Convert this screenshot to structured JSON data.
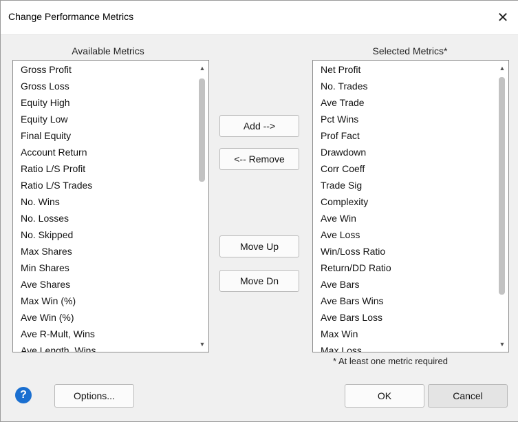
{
  "window": {
    "title": "Change Performance Metrics",
    "close_glyph": "✕"
  },
  "available": {
    "header": "Available Metrics",
    "items": [
      "Gross Profit",
      "Gross Loss",
      "Equity High",
      "Equity Low",
      "Final Equity",
      "Account Return",
      "Ratio L/S Profit",
      "Ratio L/S Trades",
      "No. Wins",
      "No. Losses",
      "No. Skipped",
      "Max Shares",
      "Min Shares",
      "Ave Shares",
      "Max Win (%)",
      "Ave Win (%)",
      "Ave R-Mult, Wins",
      "Ave Length, Wins"
    ]
  },
  "selected": {
    "header": "Selected Metrics*",
    "items": [
      "Net Profit",
      "No. Trades",
      "Ave Trade",
      "Pct Wins",
      "Prof Fact",
      "Drawdown",
      "Corr Coeff",
      "Trade Sig",
      "Complexity",
      "Ave Win",
      "Ave Loss",
      "Win/Loss Ratio",
      "Return/DD Ratio",
      "Ave Bars",
      "Ave Bars Wins",
      "Ave Bars Loss",
      "Max Win",
      "Max Loss"
    ],
    "note": "* At least one metric required"
  },
  "buttons": {
    "add": "Add -->",
    "remove": "<-- Remove",
    "move_up": "Move Up",
    "move_dn": "Move Dn",
    "options": "Options...",
    "ok": "OK",
    "cancel": "Cancel",
    "help": "?"
  },
  "icons": {
    "help": "help-icon",
    "close": "close-icon",
    "scroll_up": "scroll-up-arrow-icon",
    "scroll_down": "scroll-down-arrow-icon"
  },
  "colors": {
    "help_blue": "#1a6fd0",
    "dialog_bg": "#f0f0f0"
  }
}
